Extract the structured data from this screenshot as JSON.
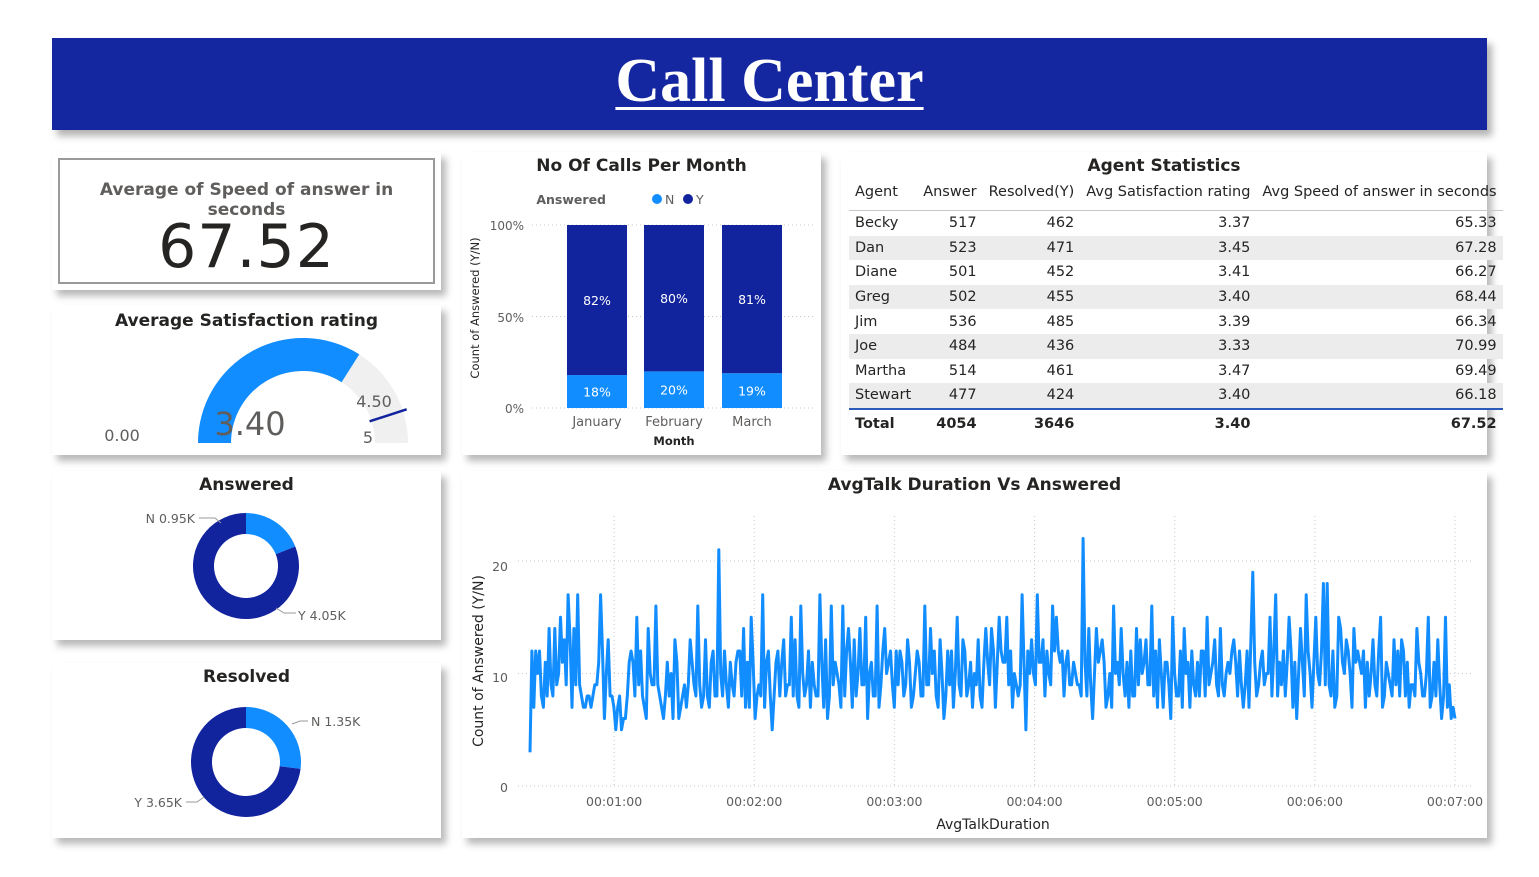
{
  "header": {
    "title": "Call Center"
  },
  "kpi": {
    "label": "Average of Speed of answer in seconds",
    "value": "67.52"
  },
  "gauge": {
    "title": "Average Satisfaction rating",
    "value": 3.4,
    "value_label": "3.40",
    "min": 0,
    "min_label": "0.00",
    "max": 5,
    "max_label": "5",
    "target": 4.5,
    "target_label": "4.50",
    "fill_color": "#118dff",
    "track_color": "#f0f0f0",
    "target_color": "#12239e"
  },
  "answered_donut": {
    "title": "Answered",
    "slices": [
      {
        "name": "N",
        "value": 0.95,
        "label": "N 0.95K",
        "color": "#118dff"
      },
      {
        "name": "Y",
        "value": 4.05,
        "label": "Y 4.05K",
        "color": "#12239e"
      }
    ]
  },
  "resolved_donut": {
    "title": "Resolved",
    "slices": [
      {
        "name": "N",
        "value": 1.35,
        "label": "N 1.35K",
        "color": "#118dff"
      },
      {
        "name": "Y",
        "value": 3.65,
        "label": "Y 3.65K",
        "color": "#12239e"
      }
    ]
  },
  "calls_per_month": {
    "title": "No Of Calls Per Month",
    "legend_title": "Answered",
    "ylabel": "Count of Answered (Y/N)",
    "xlabel": "Month",
    "y_ticks": [
      "100%",
      "50%",
      "0%"
    ],
    "chart_data": {
      "type": "bar",
      "stacked": "100%",
      "categories": [
        "January",
        "February",
        "March"
      ],
      "series": [
        {
          "name": "N",
          "values": [
            18,
            20,
            19
          ],
          "labels": [
            "18%",
            "20%",
            "19%"
          ],
          "color": "#118dff"
        },
        {
          "name": "Y",
          "values": [
            82,
            80,
            81
          ],
          "labels": [
            "82%",
            "80%",
            "81%"
          ],
          "color": "#12239e"
        }
      ],
      "ylim": [
        0,
        100
      ]
    }
  },
  "agent_stats": {
    "title": "Agent Statistics",
    "columns": [
      "Agent",
      "Answer",
      "Resolved(Y)",
      "Avg Satisfaction rating",
      "Avg Speed of answer in seconds"
    ],
    "rows": [
      [
        "Becky",
        "517",
        "462",
        "3.37",
        "65.33"
      ],
      [
        "Dan",
        "523",
        "471",
        "3.45",
        "67.28"
      ],
      [
        "Diane",
        "501",
        "452",
        "3.41",
        "66.27"
      ],
      [
        "Greg",
        "502",
        "455",
        "3.40",
        "68.44"
      ],
      [
        "Jim",
        "536",
        "485",
        "3.39",
        "66.34"
      ],
      [
        "Joe",
        "484",
        "436",
        "3.33",
        "70.99"
      ],
      [
        "Martha",
        "514",
        "461",
        "3.47",
        "69.49"
      ],
      [
        "Stewart",
        "477",
        "424",
        "3.40",
        "66.18"
      ]
    ],
    "total": [
      "Total",
      "4054",
      "3646",
      "3.40",
      "67.52"
    ]
  },
  "talk_chart": {
    "title": "AvgTalk Duration Vs Answered",
    "xlabel": "AvgTalkDuration",
    "ylabel": "Count of Answered (Y/N)",
    "x_ticks": [
      "00:01:00",
      "00:02:00",
      "00:03:00",
      "00:04:00",
      "00:05:00",
      "00:06:00",
      "00:07:00"
    ],
    "y_ticks": [
      "20",
      "10",
      "0"
    ],
    "chart_data": {
      "type": "line",
      "x_range_seconds": [
        24,
        420
      ],
      "ylim": [
        0,
        24
      ],
      "line_color": "#118dff",
      "series": [
        {
          "values": [
            3,
            12,
            7,
            12,
            10,
            12,
            8,
            7,
            11,
            8,
            14,
            9,
            8,
            14,
            9,
            10,
            15,
            11,
            13,
            9,
            17,
            13,
            7,
            14,
            9,
            17,
            9,
            8,
            7,
            7,
            8,
            8,
            7,
            8,
            9,
            9,
            11,
            17,
            12,
            6,
            10,
            13,
            8,
            8,
            7,
            5,
            7,
            8,
            5,
            6,
            6,
            8,
            11,
            12,
            11,
            8,
            15,
            9,
            12,
            8,
            7,
            6,
            14,
            10,
            9,
            9,
            16,
            9,
            8,
            7,
            6,
            8,
            11,
            8,
            10,
            6,
            13,
            11,
            6,
            7,
            8,
            9,
            7,
            9,
            13,
            11,
            9,
            8,
            16,
            9,
            7,
            8,
            13,
            8,
            7,
            11,
            12,
            8,
            8,
            21,
            10,
            8,
            12,
            9,
            7,
            11,
            9,
            8,
            11,
            12,
            12,
            8,
            14,
            7,
            11,
            7,
            15,
            11,
            6,
            8,
            9,
            8,
            17,
            7,
            11,
            12,
            8,
            5,
            8,
            11,
            12,
            8,
            11,
            13,
            8,
            9,
            9,
            15,
            8,
            13,
            8,
            7,
            16,
            10,
            8,
            9,
            12,
            7,
            11,
            9,
            8,
            8,
            17,
            11,
            7,
            13,
            6,
            8,
            16,
            9,
            11,
            10,
            9,
            7,
            16,
            8,
            12,
            14,
            11,
            7,
            13,
            8,
            10,
            14,
            9,
            9,
            15,
            6,
            10,
            11,
            8,
            8,
            16,
            7,
            9,
            12,
            14,
            10,
            11,
            12,
            9,
            7,
            12,
            9,
            12,
            11,
            8,
            9,
            13,
            11,
            7,
            8,
            10,
            12,
            11,
            8,
            8,
            16,
            9,
            9,
            14,
            10,
            12,
            8,
            7,
            13,
            10,
            6,
            8,
            12,
            9,
            12,
            7,
            10,
            15,
            9,
            8,
            13,
            12,
            8,
            9,
            11,
            7,
            10,
            9,
            13,
            8,
            7,
            11,
            14,
            11,
            9,
            14,
            12,
            7,
            11,
            15,
            12,
            11,
            11,
            15,
            9,
            12,
            7,
            10,
            9,
            8,
            9,
            17,
            11,
            5,
            12,
            10,
            13,
            10,
            9,
            17,
            11,
            11,
            13,
            8,
            12,
            10,
            9,
            16,
            12,
            15,
            12,
            11,
            12,
            8,
            11,
            12,
            9,
            9,
            11,
            10,
            9,
            9,
            8,
            22,
            11,
            8,
            14,
            9,
            6,
            10,
            14,
            11,
            12,
            13,
            11,
            7,
            8,
            10,
            7,
            16,
            10,
            11,
            9,
            14,
            10,
            8,
            11,
            7,
            12,
            8,
            8,
            14,
            9,
            13,
            10,
            11,
            13,
            9,
            9,
            16,
            8,
            12,
            7,
            13,
            10,
            7,
            11,
            11,
            9,
            6,
            15,
            10,
            8,
            8,
            12,
            7,
            14,
            10,
            11,
            7,
            12,
            9,
            8,
            11,
            8,
            12,
            12,
            8,
            15,
            9,
            10,
            11,
            13,
            9,
            8,
            14,
            9,
            8,
            10,
            11,
            10,
            12,
            13,
            11,
            8,
            12,
            9,
            7,
            9,
            12,
            7,
            13,
            19,
            11,
            8,
            9,
            11,
            12,
            9,
            10,
            10,
            15,
            8,
            12,
            17,
            8,
            11,
            9,
            12,
            8,
            11,
            15,
            12,
            7,
            11,
            6,
            10,
            14,
            11,
            8,
            17,
            12,
            10,
            7,
            11,
            15,
            10,
            9,
            12,
            18,
            9,
            18,
            9,
            8,
            12,
            7,
            8,
            15,
            14,
            11,
            10,
            13,
            12,
            10,
            7,
            14,
            11,
            12,
            11,
            10,
            12,
            7,
            11,
            8,
            10,
            13,
            9,
            8,
            12,
            15,
            7,
            8,
            11,
            10,
            9,
            8,
            13,
            9,
            12,
            8,
            13,
            12,
            8,
            11,
            7,
            9,
            9,
            8,
            14,
            11,
            10,
            8,
            8,
            10,
            15,
            7,
            8,
            11,
            8,
            13,
            9,
            6,
            8,
            15,
            7,
            9,
            6,
            7,
            6
          ]
        }
      ]
    }
  }
}
